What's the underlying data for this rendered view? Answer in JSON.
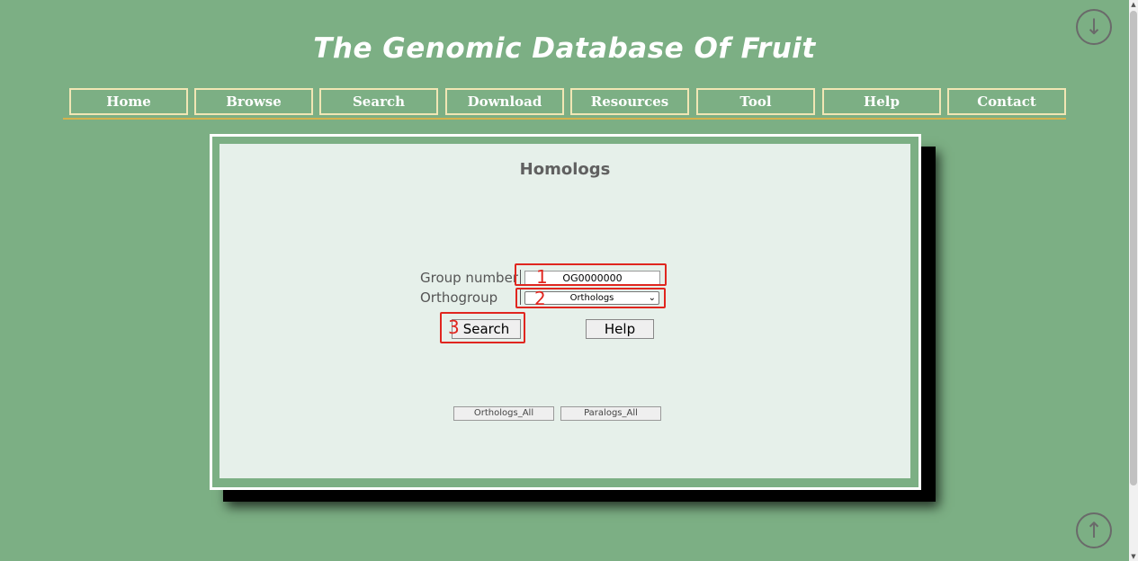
{
  "site": {
    "title": "The Genomic Database Of Fruit"
  },
  "nav": {
    "items": [
      "Home",
      "Browse",
      "Search",
      "Download",
      "Resources",
      "Tool",
      "Help",
      "Contact"
    ]
  },
  "panel": {
    "title": "Homologs",
    "group_number_label": "Group number",
    "group_number_value": "OG0000000",
    "orthogroup_label": "Orthogroup",
    "orthogroup_selected": "Orthologs",
    "search_button": "Search",
    "help_button": "Help",
    "orthologs_all_button": "Orthologs_All",
    "paralogs_all_button": "Paralogs_All"
  },
  "annotations": {
    "one": "1",
    "two": "2",
    "three": "3"
  },
  "icons": {
    "scroll_down": "arrow-down-circle-icon",
    "scroll_up": "arrow-up-circle-icon"
  },
  "colors": {
    "background": "#7caf84",
    "panel": "#e6f0ea",
    "nav_border": "#f1e6b4",
    "accent_rule": "#d4b24e",
    "annotation": "#e0261f"
  }
}
